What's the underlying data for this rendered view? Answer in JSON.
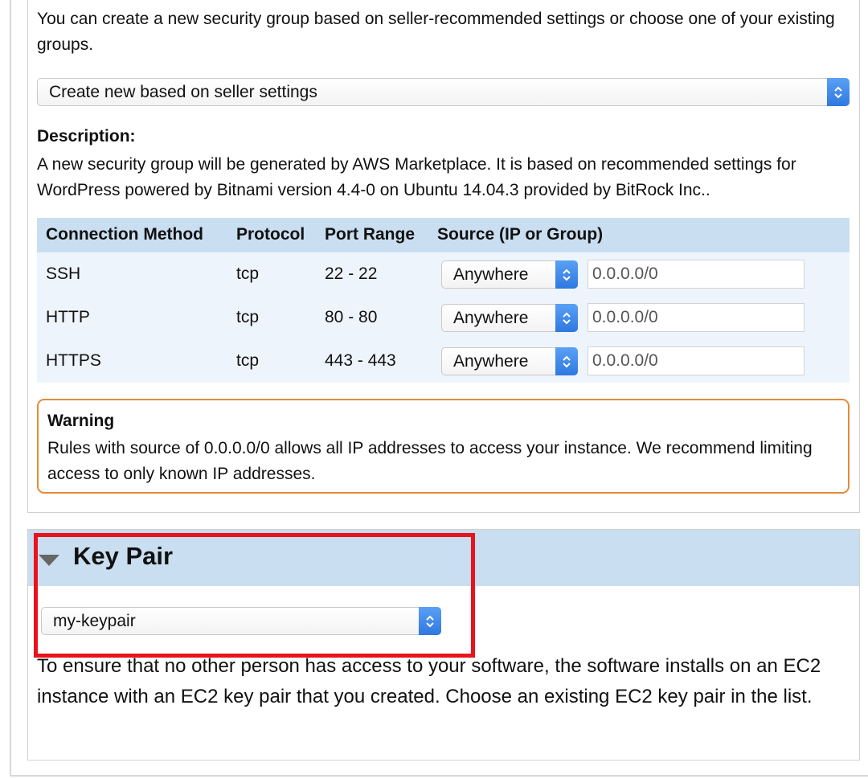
{
  "security_group": {
    "intro": "You can create a new security group based on seller-recommended settings or choose one of your existing groups.",
    "select_value": "Create new based on seller settings",
    "description_title": "Description:",
    "description_text": "A new security group will be generated by AWS Marketplace. It is based on recommended settings for WordPress powered by Bitnami version 4.4-0 on Ubuntu 14.04.3 provided by BitRock Inc..",
    "table": {
      "headers": [
        "Connection Method",
        "Protocol",
        "Port Range",
        "Source (IP or Group)"
      ],
      "rows": [
        {
          "method": "SSH",
          "protocol": "tcp",
          "port_range": "22 - 22",
          "source_select": "Anywhere",
          "source_ip": "0.0.0.0/0"
        },
        {
          "method": "HTTP",
          "protocol": "tcp",
          "port_range": "80 - 80",
          "source_select": "Anywhere",
          "source_ip": "0.0.0.0/0"
        },
        {
          "method": "HTTPS",
          "protocol": "tcp",
          "port_range": "443 - 443",
          "source_select": "Anywhere",
          "source_ip": "0.0.0.0/0"
        }
      ]
    },
    "warning": {
      "title": "Warning",
      "text": "Rules with source of 0.0.0.0/0 allows all IP addresses to access your instance. We recommend limiting access to only known IP addresses."
    }
  },
  "key_pair": {
    "title": "Key Pair",
    "select_value": "my-keypair",
    "description": "To ensure that no other person has access to your software, the software installs on an EC2 instance with an EC2 key pair that you created. Choose an existing EC2 key pair in the list."
  },
  "icons": {
    "select_arrows": "chevron-up-down-icon",
    "collapse": "triangle-down-icon"
  },
  "colors": {
    "header_blue": "#c9def0",
    "table_bg": "#eef4fb",
    "warning_border": "#e58a3a",
    "highlight_red": "#e8141b",
    "select_accent": "#2f78e0"
  }
}
